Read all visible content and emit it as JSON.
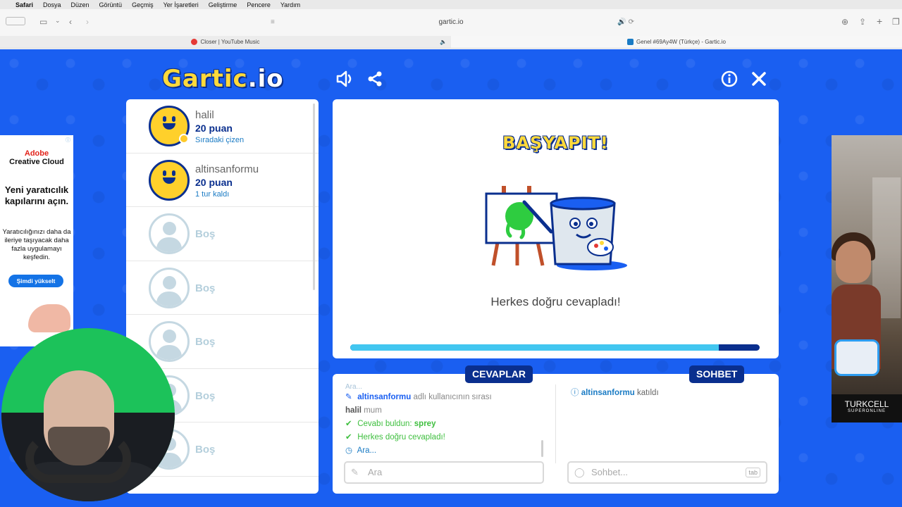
{
  "menubar": {
    "items": [
      {
        "label": "Safari",
        "bold": true
      },
      {
        "label": "Dosya"
      },
      {
        "label": "Düzen"
      },
      {
        "label": "Görüntü"
      },
      {
        "label": "Geçmiş"
      },
      {
        "label": "Yer İşaretleri"
      },
      {
        "label": "Geliştirme"
      },
      {
        "label": "Pencere"
      },
      {
        "label": "Yardım"
      }
    ]
  },
  "browser": {
    "address": "gartic.io",
    "tabs": [
      {
        "title": "Closer | YouTube Music",
        "active": false
      },
      {
        "title": "Genel #69Ay4W (Türkçe) - Gartic.io",
        "active": true
      }
    ]
  },
  "game": {
    "logo_main": "Gartic",
    "logo_suffix": ".io",
    "players": [
      {
        "name": "halil",
        "points": "20 puan",
        "status": "Sıradaki çizen",
        "filled": true
      },
      {
        "name": "altinsanformu",
        "points": "20 puan",
        "status": "1 tur kaldı",
        "filled": true
      },
      {
        "empty_label": "Boş"
      },
      {
        "empty_label": "Boş"
      },
      {
        "empty_label": "Boş"
      },
      {
        "empty_label": "Boş"
      },
      {
        "empty_label": "Boş"
      }
    ],
    "banner": "BAŞYAPIT!",
    "result_text": "Herkes doğru cevapladı!",
    "round_progress": 0.9,
    "answers_tab": "CEVAPLAR",
    "chat_tab": "SOHBET",
    "answers": {
      "top_partial": "Ara...",
      "turn_user": "altinsanformu",
      "turn_text": "adlı kullanıcının sırası",
      "guess_user": "halil",
      "guess_word": "mum",
      "found_text": "Cevabı buldun:",
      "found_word": "sprey",
      "all_text": "Herkes doğru cevapladı!",
      "ara_text": "Ara..."
    },
    "chat": {
      "join_user": "altinsanformu",
      "join_text": "katıldı"
    },
    "answer_input_placeholder": "Ara",
    "chat_input_placeholder": "Sohbet...",
    "tab_key": "tab"
  },
  "ads": {
    "left": {
      "brand_line1": "Adobe",
      "brand_line2": "Creative Cloud",
      "headline": "Yeni yaratıcılık kapılarını açın.",
      "body": "Yaratıcılığınızı daha da ileriye taşıyacak daha fazla uygulamayı keşfedin.",
      "cta": "Şimdi yükselt"
    },
    "right": {
      "brand": "TURKCELL",
      "sub": "SUPERONLINE"
    }
  }
}
